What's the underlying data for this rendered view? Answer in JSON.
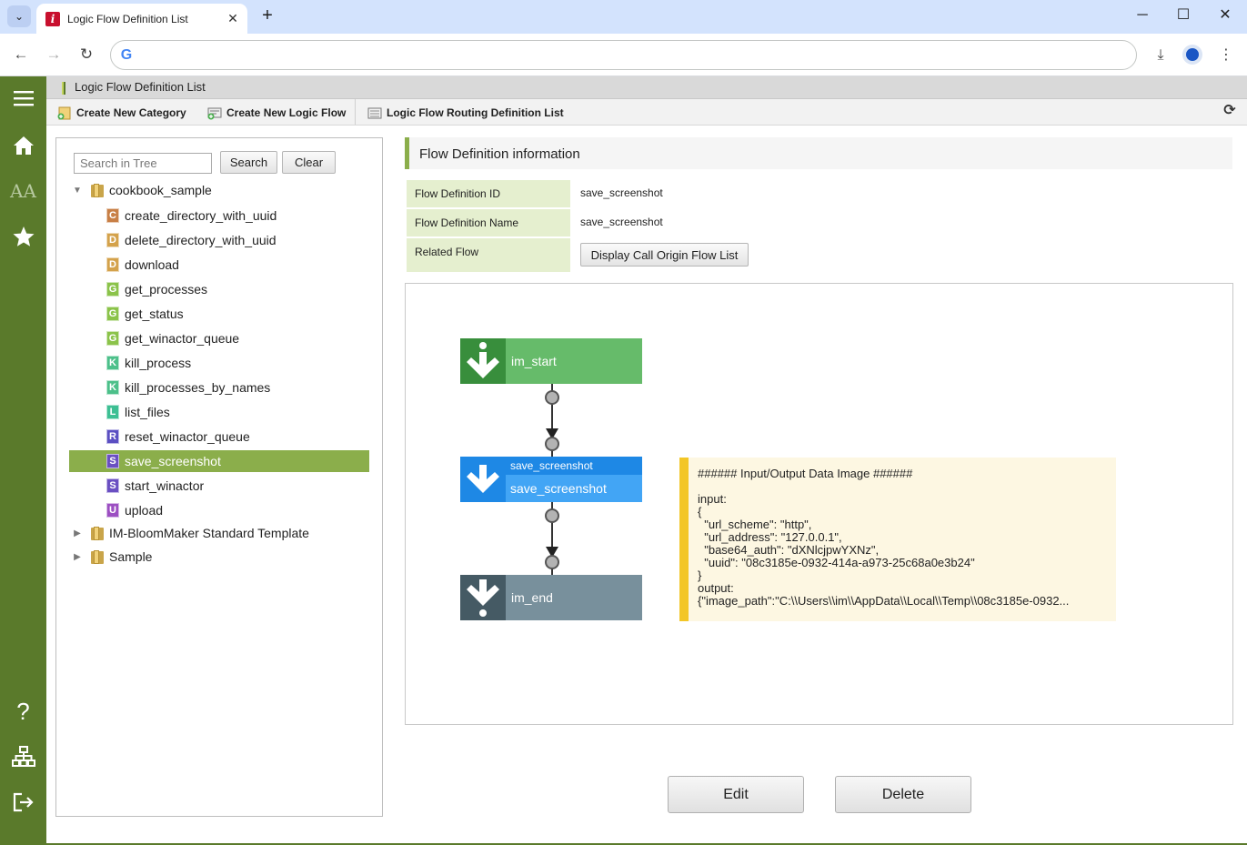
{
  "browser": {
    "tab_title": "Logic Flow Definition List",
    "tab_close": "✕",
    "new_tab": "+",
    "address_value": ""
  },
  "page": {
    "title": "Logic Flow Definition List"
  },
  "toolbar": {
    "create_category": "Create New Category",
    "create_flow": "Create New Logic Flow",
    "routing_list": "Logic Flow Routing Definition List"
  },
  "tree": {
    "search_placeholder": "Search in Tree",
    "search_label": "Search",
    "clear_label": "Clear",
    "root_folder": "cookbook_sample",
    "items": [
      {
        "badge": "C",
        "color": "#c87f46",
        "label": "create_directory_with_uuid"
      },
      {
        "badge": "D",
        "color": "#d4a24b",
        "label": "delete_directory_with_uuid"
      },
      {
        "badge": "D",
        "color": "#d4a24b",
        "label": "download"
      },
      {
        "badge": "G",
        "color": "#8bc34a",
        "label": "get_processes"
      },
      {
        "badge": "G",
        "color": "#8bc34a",
        "label": "get_status"
      },
      {
        "badge": "G",
        "color": "#8bc34a",
        "label": "get_winactor_queue"
      },
      {
        "badge": "K",
        "color": "#4cc08a",
        "label": "kill_process"
      },
      {
        "badge": "K",
        "color": "#4cc08a",
        "label": "kill_processes_by_names"
      },
      {
        "badge": "L",
        "color": "#3dbf93",
        "label": "list_files"
      },
      {
        "badge": "R",
        "color": "#5b4fc2",
        "label": "reset_winactor_queue"
      },
      {
        "badge": "S",
        "color": "#6a4fc2",
        "label": "save_screenshot"
      },
      {
        "badge": "S",
        "color": "#6a4fc2",
        "label": "start_winactor"
      },
      {
        "badge": "U",
        "color": "#9c4fc2",
        "label": "upload"
      }
    ],
    "folders": [
      "IM-BloomMaker Standard Template",
      "Sample"
    ]
  },
  "info": {
    "heading": "Flow Definition information",
    "id_label": "Flow Definition ID",
    "id_value": "save_screenshot",
    "name_label": "Flow Definition Name",
    "name_value": "save_screenshot",
    "related_label": "Related Flow",
    "related_button": "Display Call Origin Flow List"
  },
  "diagram": {
    "start_label": "im_start",
    "task_top": "save_screenshot",
    "task_bottom": "save_screenshot",
    "end_label": "im_end",
    "io_text": "###### Input/Output Data Image ######\n\ninput:\n{\n  \"url_scheme\": \"http\",\n  \"url_address\": \"127.0.0.1\",\n  \"base64_auth\": \"dXNlcjpwYXNz\",\n  \"uuid\": \"08c3185e-0932-414a-a973-25c68a0e3b24\"\n}\noutput:\n{\"image_path\":\"C:\\\\Users\\\\im\\\\AppData\\\\Local\\\\Temp\\\\08c3185e-0932..."
  },
  "actions": {
    "edit": "Edit",
    "delete": "Delete"
  },
  "colors": {
    "sidebar": "#5a7a2b",
    "accent": "#8bae4b",
    "start_node": "#66bb6a",
    "task_node": "#42a5f5",
    "end_node": "#78909c"
  }
}
